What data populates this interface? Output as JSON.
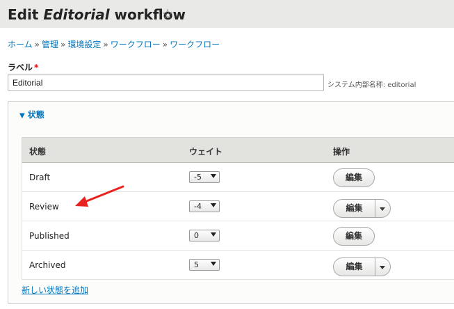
{
  "header": {
    "title_prefix": "Edit ",
    "title_name": "Editorial",
    "title_suffix": " workflow",
    "star_icon": "star-outline-icon"
  },
  "breadcrumb": [
    "ホーム",
    "管理",
    "環境設定",
    "ワークフロー",
    "ワークフロー"
  ],
  "breadcrumb_sep": "»",
  "form": {
    "label": "ラベル",
    "required_mark": "*",
    "label_value": "Editorial",
    "machine_name": "システム内部名称: editorial"
  },
  "states": {
    "legend": "状態",
    "columns": {
      "state": "状態",
      "weight": "ウェイト",
      "operations": "操作"
    },
    "rows": [
      {
        "name": "Draft",
        "weight": "-5",
        "edit": "編集",
        "has_dropdown": false
      },
      {
        "name": "Review",
        "weight": "-4",
        "edit": "編集",
        "has_dropdown": true
      },
      {
        "name": "Published",
        "weight": "0",
        "edit": "編集",
        "has_dropdown": false
      },
      {
        "name": "Archived",
        "weight": "5",
        "edit": "編集",
        "has_dropdown": true
      }
    ],
    "add_link": "新しい状態を追加"
  },
  "colors": {
    "link": "#0074bd",
    "header_bg": "#e9e9e7",
    "required": "#ee0000",
    "annotation_arrow": "#e8231f"
  }
}
